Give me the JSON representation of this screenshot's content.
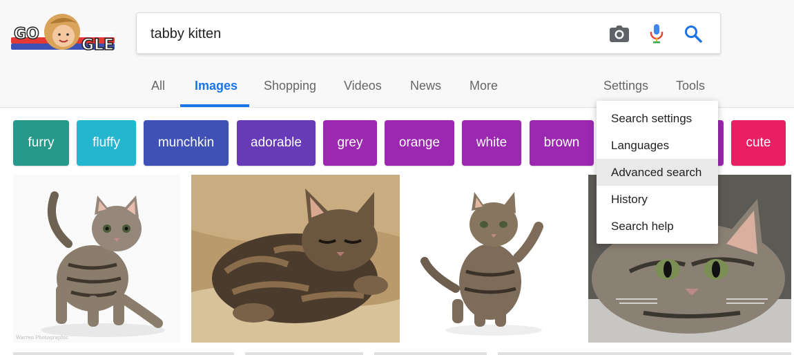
{
  "search": {
    "query": "tabby kitten"
  },
  "icons": {
    "camera": "camera-icon",
    "mic": "microphone-icon",
    "search": "search-icon"
  },
  "tabs": [
    {
      "label": "All",
      "active": false
    },
    {
      "label": "Images",
      "active": true
    },
    {
      "label": "Shopping",
      "active": false
    },
    {
      "label": "Videos",
      "active": false
    },
    {
      "label": "News",
      "active": false
    },
    {
      "label": "More",
      "active": false
    }
  ],
  "right_tabs": {
    "settings": "Settings",
    "tools": "Tools"
  },
  "chips": [
    {
      "label": "furry",
      "color": "#26998b"
    },
    {
      "label": "fluffy",
      "color": "#25b6cf"
    },
    {
      "label": "munchkin",
      "color": "#3f51b5"
    },
    {
      "label": "adorable",
      "color": "#673ab7"
    },
    {
      "label": "grey",
      "color": "#9c27b0"
    },
    {
      "label": "orange",
      "color": "#9c27b0"
    },
    {
      "label": "white",
      "color": "#9c27b0"
    },
    {
      "label": "brown",
      "color": "#9c27b0"
    },
    {
      "label": "cute",
      "color": "#e91e63"
    }
  ],
  "settings_menu": {
    "items": [
      "Search settings",
      "Languages",
      "Advanced search",
      "History",
      "Search help"
    ],
    "highlighted": "Advanced search"
  },
  "colors": {
    "accent": "#1a73e8"
  }
}
